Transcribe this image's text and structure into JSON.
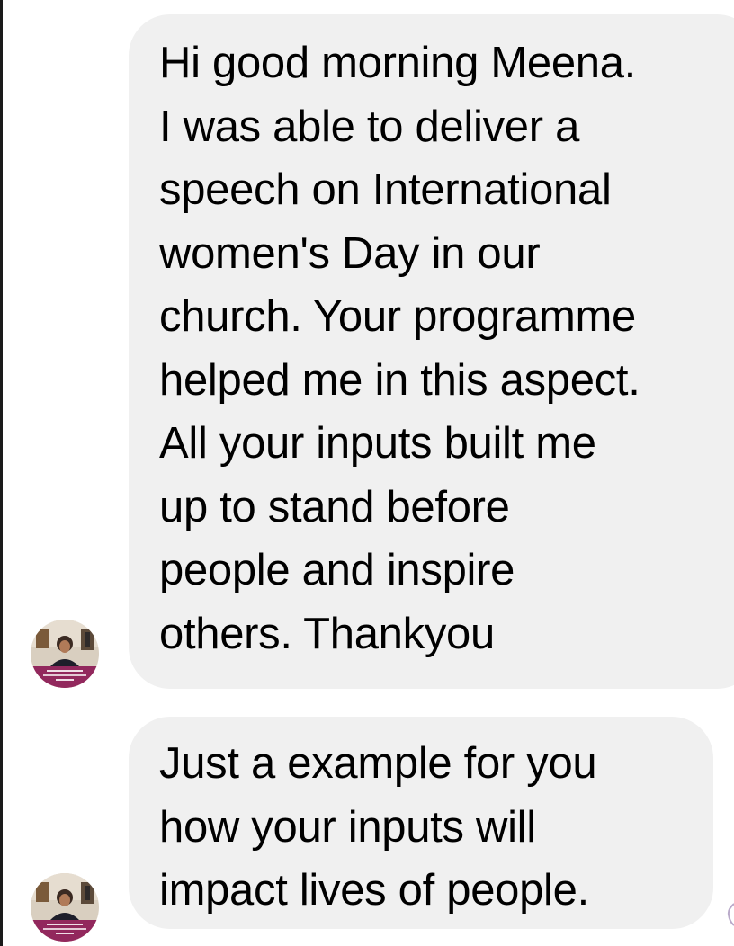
{
  "conversation": {
    "messages": [
      {
        "text": "Hi good morning Meena.\nI was able to deliver a\nspeech on International\nwomen's Day in our\nchurch. Your programme\nhelped me in this aspect.\nAll your inputs built me\nup to stand before\npeople and inspire\nothers. Thankyou"
      },
      {
        "text": "Just a example for you\nhow your inputs will\nimpact lives of people."
      }
    ]
  },
  "theme": {
    "bubble_color": "#f0f0f0",
    "text_color": "#000000",
    "background": "#ffffff"
  }
}
